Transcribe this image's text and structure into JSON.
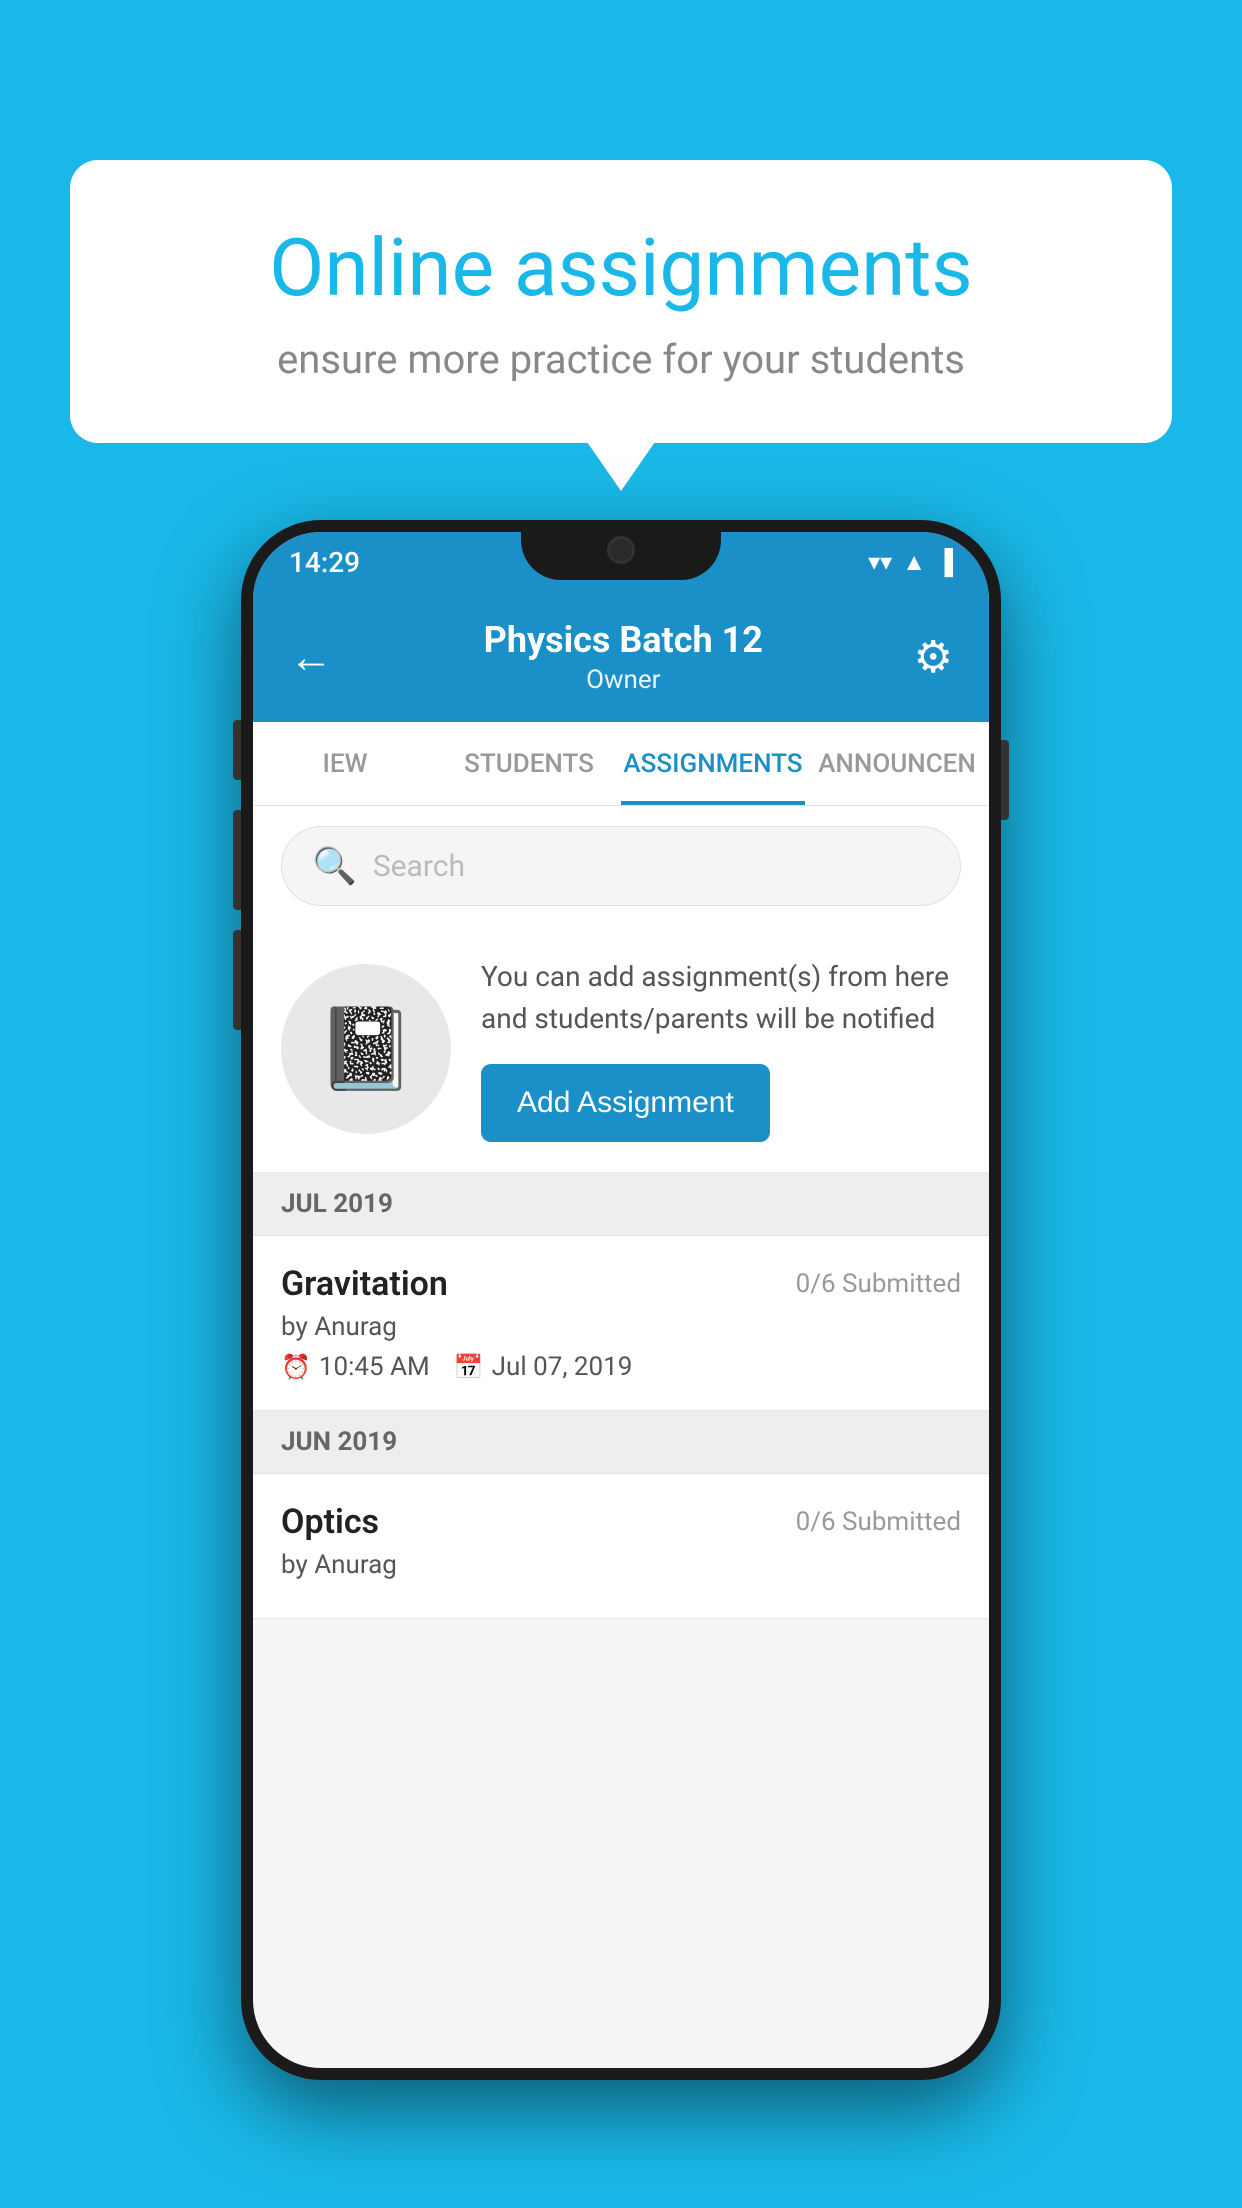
{
  "background_color": "#1ab8e8",
  "speech_bubble": {
    "title": "Online assignments",
    "subtitle": "ensure more practice for your students"
  },
  "phone": {
    "status_bar": {
      "time": "14:29",
      "wifi": "▼",
      "signal": "▲",
      "battery": "▌"
    },
    "header": {
      "title": "Physics Batch 12",
      "subtitle": "Owner",
      "back_icon": "←",
      "gear_icon": "⚙"
    },
    "tabs": [
      {
        "label": "IEW",
        "active": false
      },
      {
        "label": "STUDENTS",
        "active": false
      },
      {
        "label": "ASSIGNMENTS",
        "active": true
      },
      {
        "label": "ANNOUNCEN",
        "active": false
      }
    ],
    "search": {
      "placeholder": "Search"
    },
    "promo": {
      "description": "You can add assignment(s) from here and students/parents will be notified",
      "button_label": "Add Assignment"
    },
    "sections": [
      {
        "month": "JUL 2019",
        "assignments": [
          {
            "name": "Gravitation",
            "submitted": "0/6 Submitted",
            "author": "by Anurag",
            "time": "10:45 AM",
            "date": "Jul 07, 2019"
          }
        ]
      },
      {
        "month": "JUN 2019",
        "assignments": [
          {
            "name": "Optics",
            "submitted": "0/6 Submitted",
            "author": "by Anurag",
            "time": "",
            "date": ""
          }
        ]
      }
    ]
  }
}
